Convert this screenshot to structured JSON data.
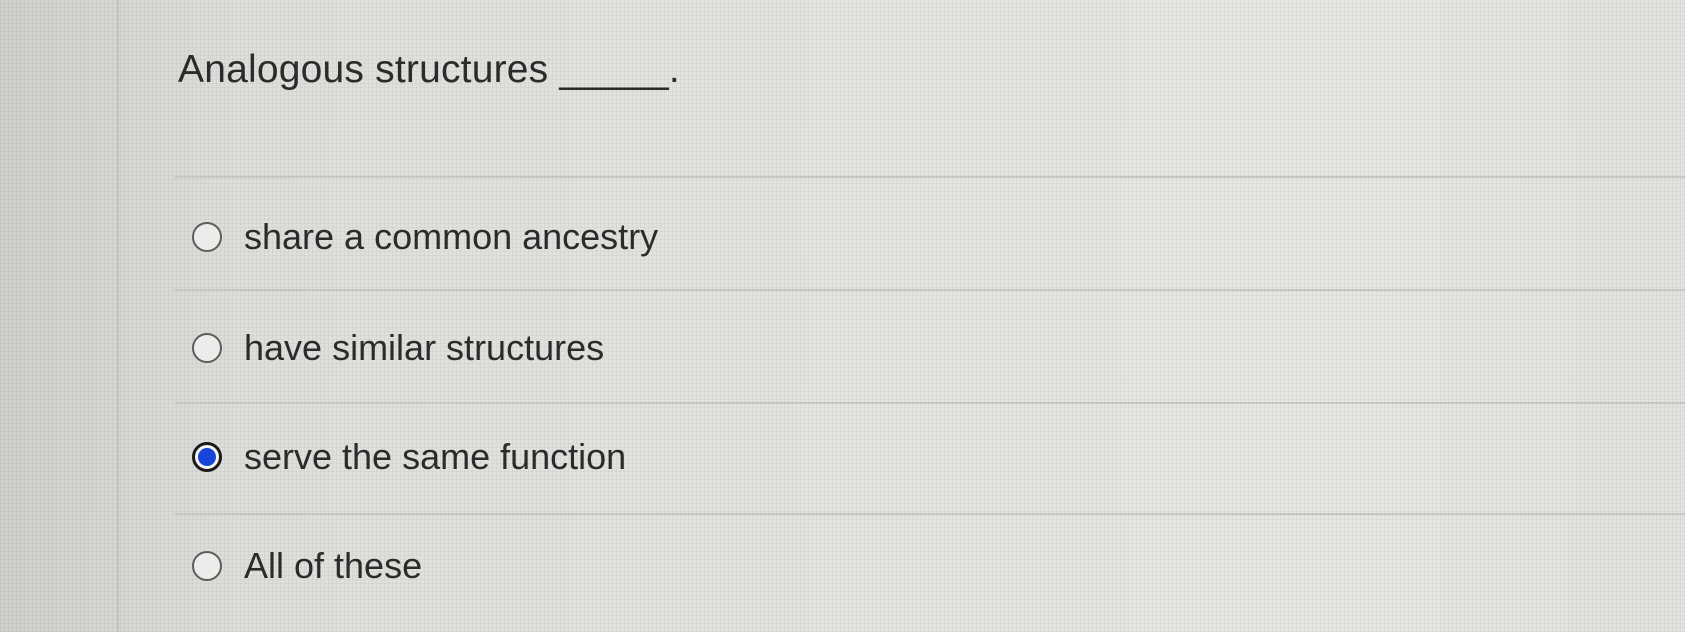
{
  "question": {
    "text": "Analogous structures _____."
  },
  "options": [
    {
      "label": "share a common ancestry",
      "selected": false
    },
    {
      "label": "have similar structures",
      "selected": false
    },
    {
      "label": "serve the same function",
      "selected": true
    },
    {
      "label": "All of these",
      "selected": false
    }
  ],
  "colors": {
    "selected_radio": "#1745d8",
    "text": "#2b2b2b",
    "background": "#e3e3e0"
  }
}
